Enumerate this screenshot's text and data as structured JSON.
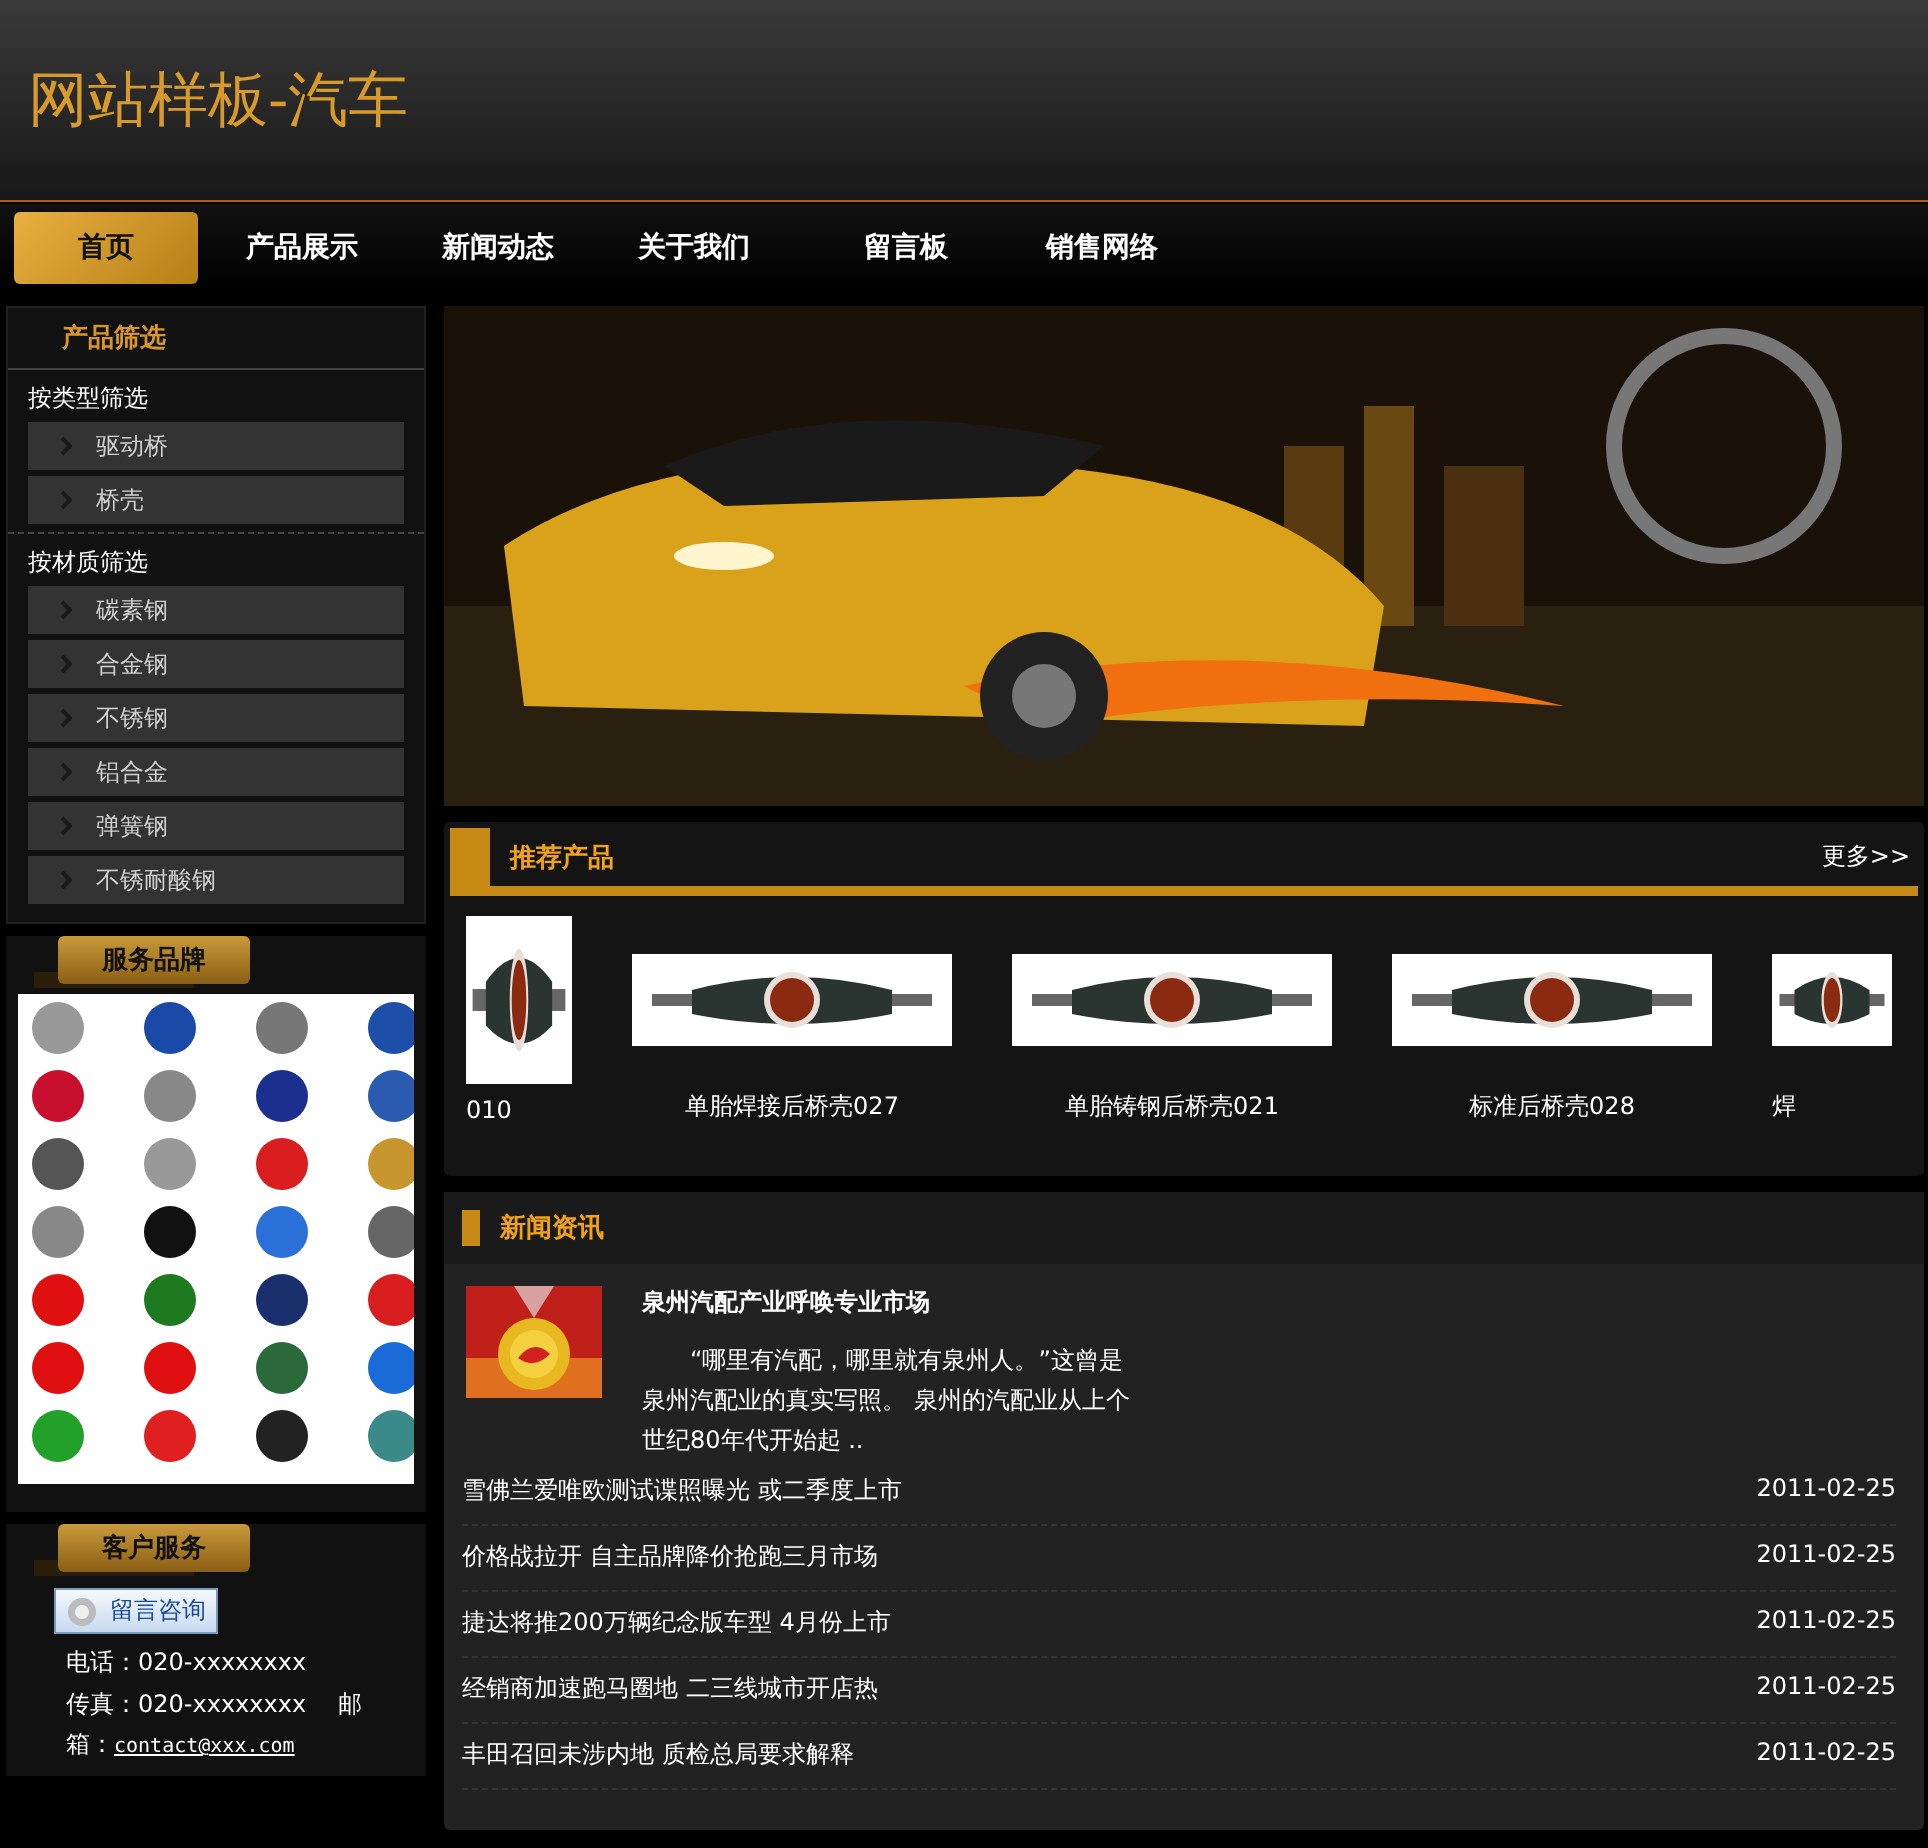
{
  "site_title": "网站样板-汽车",
  "nav": [
    {
      "label": "首页",
      "selected": true
    },
    {
      "label": "产品展示",
      "selected": false
    },
    {
      "label": "新闻动态",
      "selected": false
    },
    {
      "label": "关于我们",
      "selected": false
    },
    {
      "label": "留言板",
      "selected": false
    },
    {
      "label": "销售网络",
      "selected": false
    }
  ],
  "filter": {
    "title": "产品筛选",
    "groups": [
      {
        "heading": "按类型筛选",
        "items": [
          "驱动桥",
          "桥壳"
        ]
      },
      {
        "heading": "按材质筛选",
        "items": [
          "碳素钢",
          "合金钢",
          "不锈钢",
          "铝合金",
          "弹簧钢",
          "不锈耐酸钢"
        ]
      }
    ]
  },
  "brands": {
    "title": "服务品牌",
    "kind": "picture"
  },
  "service": {
    "title": "客户服务",
    "button": "留言咨询",
    "phone": "电话：020-xxxxxxxx",
    "fax": "传真：020-xxxxxxxx",
    "email_label": "邮箱：",
    "email": "contact@xxx.com"
  },
  "products": {
    "title": "推荐产品",
    "more": "更多>>",
    "items": [
      {
        "name": "010"
      },
      {
        "name": "单胎焊接后桥壳027"
      },
      {
        "name": "单胎铸钢后桥壳021"
      },
      {
        "name": "标准后桥壳028"
      },
      {
        "name": "焊"
      }
    ]
  },
  "news": {
    "title": "新闻资讯",
    "featured": {
      "title": "泉州汽配产业呼唤专业市场",
      "summary": "“哪里有汽配，哪里就有泉州人。”这曾是泉州汽配业的真实写照。 泉州的汽配业从上个世纪80年代开始起 .."
    },
    "items": [
      {
        "title": "雪佛兰爱唯欧测试谍照曝光 或二季度上市",
        "date": "2011-02-25"
      },
      {
        "title": "价格战拉开 自主品牌降价抢跑三月市场",
        "date": "2011-02-25"
      },
      {
        "title": "捷达将推200万辆纪念版车型 4月份上市",
        "date": "2011-02-25"
      },
      {
        "title": "经销商加速跑马圈地 二三线城市开店热",
        "date": "2011-02-25"
      },
      {
        "title": "丰田召回未涉内地 质检总局要求解释",
        "date": "2011-02-25"
      }
    ]
  }
}
